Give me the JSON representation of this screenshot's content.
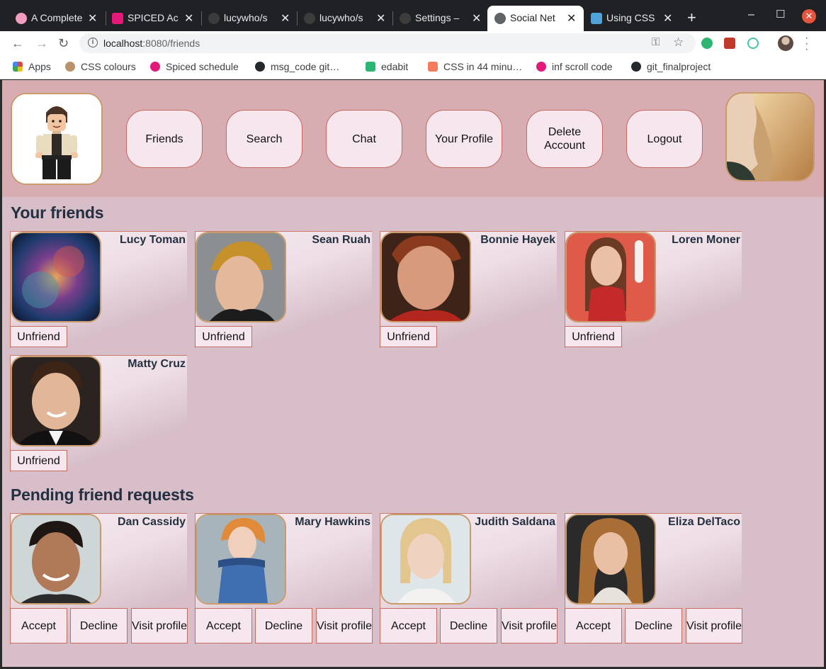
{
  "browser": {
    "tabs": [
      {
        "title": "A Complete",
        "color": "#f29cc1"
      },
      {
        "title": "SPICED Ac",
        "color": "#e4197a"
      },
      {
        "title": "lucywho/s",
        "color": "#3c3c3c"
      },
      {
        "title": "lucywho/s",
        "color": "#3c3c3c"
      },
      {
        "title": "Settings –",
        "color": "#3c3c3c"
      },
      {
        "title": "Social Net",
        "color": "#5f6368"
      },
      {
        "title": "Using CSS",
        "color": "#4fa3d8"
      }
    ],
    "url_host": "localhost",
    "url_path": ":8080/friends",
    "bookmarks": [
      {
        "label": "Apps",
        "color": "#ea4335"
      },
      {
        "label": "CSS colours",
        "color": "#b9926b"
      },
      {
        "label": "Spiced schedule",
        "color": "#e4197a"
      },
      {
        "label": "msg_code git…",
        "color": "#24292e"
      },
      {
        "label": "edabit",
        "color": "#2bb673"
      },
      {
        "label": "CSS in 44 minu…",
        "color": "#f47b5e"
      },
      {
        "label": "inf scroll code",
        "color": "#e4197a"
      },
      {
        "label": "git_finalproject",
        "color": "#24292e"
      }
    ]
  },
  "nav": {
    "friends": "Friends",
    "search": "Search",
    "chat": "Chat",
    "profile": "Your Profile",
    "delete": "Delete Account",
    "logout": "Logout"
  },
  "friends": {
    "title": "Your friends",
    "unfriend_label": "Unfriend",
    "items": [
      {
        "name": "Lucy Toman"
      },
      {
        "name": "Sean Ruah"
      },
      {
        "name": "Bonnie Hayek"
      },
      {
        "name": "Loren Moner"
      },
      {
        "name": "Matty Cruz"
      }
    ]
  },
  "pending": {
    "title": "Pending friend requests",
    "accept_label": "Accept",
    "decline_label": "Decline",
    "visit_label": "Visit profile",
    "items": [
      {
        "name": "Dan Cassidy"
      },
      {
        "name": "Mary Hawkins"
      },
      {
        "name": "Judith Saldana"
      },
      {
        "name": "Eliza DelTaco"
      }
    ]
  }
}
